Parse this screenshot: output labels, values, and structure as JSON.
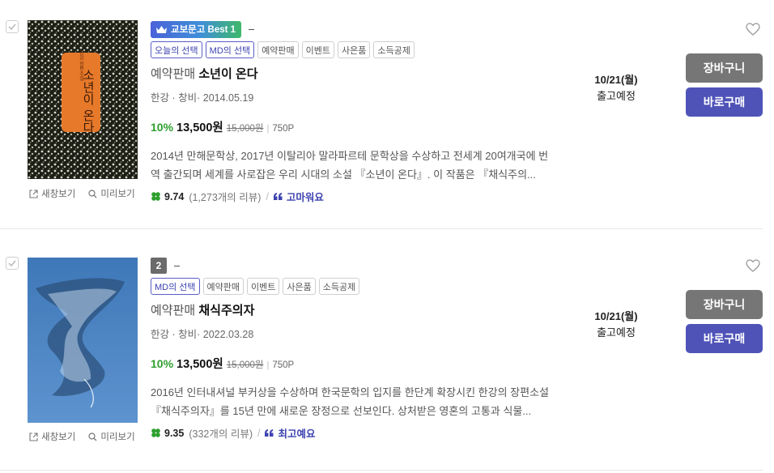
{
  "items": [
    {
      "rank_badge": "교보문고 Best 1",
      "tags": [
        {
          "label": "오늘의 선택",
          "style": "blue"
        },
        {
          "label": "MD의 선택",
          "style": "blue"
        },
        {
          "label": "예약판매",
          "style": "gray"
        },
        {
          "label": "이벤트",
          "style": "gray"
        },
        {
          "label": "사은품",
          "style": "gray"
        },
        {
          "label": "소득공제",
          "style": "gray"
        }
      ],
      "title_prefix": "예약판매",
      "title": "소년이 온다",
      "meta": "한강 · 창비· 2014.05.19",
      "discount": "10%",
      "sale_price": "13,500원",
      "original_price": "15,000원",
      "points": "750P",
      "description": "2014년 만해문학상, 2017년 이탈리아 말라파르테 문학상을 수상하고 전세계 20여개국에 번역 출간되며 세계를 사로잡은 우리 시대의 소설 『소년이 온다』. 이 작품은 『채식주의...",
      "rating": "9.74",
      "review_count": "(1,273개의 리뷰)",
      "review_keyword": "고마워요",
      "ship_date": "10/21(월)",
      "ship_status": "출고예정",
      "cover_title": "소년이 온다",
      "cover_author": "한강 장편소설"
    },
    {
      "rank_number": "2",
      "tags": [
        {
          "label": "MD의 선택",
          "style": "blue"
        },
        {
          "label": "예약판매",
          "style": "gray"
        },
        {
          "label": "이벤트",
          "style": "gray"
        },
        {
          "label": "사은품",
          "style": "gray"
        },
        {
          "label": "소득공제",
          "style": "gray"
        }
      ],
      "title_prefix": "예약판매",
      "title": "채식주의자",
      "meta": "한강 · 창비· 2022.03.28",
      "discount": "10%",
      "sale_price": "13,500원",
      "original_price": "15,000원",
      "points": "750P",
      "description": "2016년 인터내셔널 부커상을 수상하며 한국문학의 입지를 한단계 확장시킨 한강의 장편소설 『채식주의자』를 15년 만에 새로운 장정으로 선보인다. 상처받은 영혼의 고통과 식물...",
      "rating": "9.35",
      "review_count": "(332개의 리뷰)",
      "review_keyword": "최고예요",
      "ship_date": "10/21(월)",
      "ship_status": "출고예정"
    }
  ],
  "labels": {
    "new_window": "새창보기",
    "preview": "미리보기",
    "cart": "장바구니",
    "buy_now": "바로구매"
  },
  "colors": {
    "discount": "#2e9f2e",
    "buy_button": "#4f53b8",
    "cart_button": "#767676",
    "keyword": "#3d42b0"
  },
  "icons": [
    "check-icon",
    "crown-icon",
    "clover-icon",
    "quote-icon",
    "heart-icon",
    "external-link-icon",
    "magnifier-icon"
  ]
}
